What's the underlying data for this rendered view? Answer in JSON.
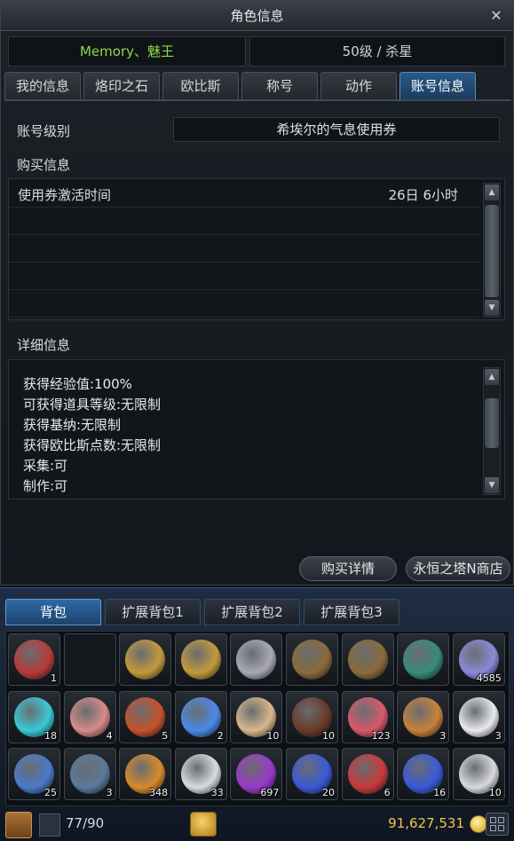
{
  "window": {
    "title": "角色信息",
    "close_glyph": "✕"
  },
  "character": {
    "name": "Memory、魅王",
    "level_class": "50级 / 杀星"
  },
  "tabs": [
    {
      "label": "我的信息"
    },
    {
      "label": "烙印之石"
    },
    {
      "label": "欧比斯"
    },
    {
      "label": "称号"
    },
    {
      "label": "动作"
    },
    {
      "label": "账号信息",
      "active": true
    }
  ],
  "account": {
    "level_label": "账号级别",
    "level_value": "希埃尔的气息使用券",
    "purchase_label": "购买信息",
    "purchase_rows": [
      {
        "key": "使用券激活时间",
        "value": "26日 6小时"
      }
    ],
    "detail_label": "详细信息",
    "detail_lines": [
      "获得经验值:100%",
      "可获得道具等级:无限制",
      "获得基纳:无限制",
      "获得欧比斯点数:无限制",
      "采集:可",
      "制作:可"
    ]
  },
  "buttons": {
    "purchase_detail": "购买详情",
    "shop": "永恒之塔N商店"
  },
  "inventory": {
    "tabs": [
      {
        "label": "背包",
        "active": true
      },
      {
        "label": "扩展背包1"
      },
      {
        "label": "扩展背包2"
      },
      {
        "label": "扩展背包3"
      }
    ],
    "slots": [
      {
        "icon": "red-feather-icon",
        "count": "1",
        "color": "#b83a3a"
      },
      {
        "icon": "empty-slot-icon",
        "count": "",
        "color": ""
      },
      {
        "icon": "gold-helmet-icon",
        "count": "",
        "color": "#c39a3c"
      },
      {
        "icon": "gold-helmet-icon",
        "count": "",
        "color": "#c39a3c"
      },
      {
        "icon": "necklace-icon",
        "count": "",
        "color": "#a9a9b8"
      },
      {
        "icon": "ring-icon",
        "count": "",
        "color": "#8a6a3a"
      },
      {
        "icon": "ring-icon",
        "count": "",
        "color": "#8a6a3a"
      },
      {
        "icon": "bracelet-icon",
        "count": "",
        "color": "#3a8a7a"
      },
      {
        "icon": "crystal-shard-icon",
        "count": "4585",
        "color": "#8a8ad8"
      },
      {
        "icon": "cyan-flame-icon",
        "count": "18",
        "color": "#3ac8d8"
      },
      {
        "icon": "raw-meat-icon",
        "count": "4",
        "color": "#d88a8a"
      },
      {
        "icon": "sausage-icon",
        "count": "5",
        "color": "#c8522a"
      },
      {
        "icon": "blue-orb-icon",
        "count": "2",
        "color": "#4a8ae8"
      },
      {
        "icon": "bread-icon",
        "count": "10",
        "color": "#d8b88a"
      },
      {
        "icon": "chocolate-icon",
        "count": "10",
        "color": "#6a3a2a"
      },
      {
        "icon": "jelly-icon",
        "count": "123",
        "color": "#d85a6a"
      },
      {
        "icon": "bun-basket-icon",
        "count": "3",
        "color": "#c8823a"
      },
      {
        "icon": "polar-bear-icon",
        "count": "3",
        "color": "#e8eaec"
      },
      {
        "icon": "blue-dragon-icon",
        "count": "25",
        "color": "#4a7ac8"
      },
      {
        "icon": "dark-crystal-icon",
        "count": "3",
        "color": "#5a7a9a"
      },
      {
        "icon": "amber-potion-icon",
        "count": "348",
        "color": "#d88a2a"
      },
      {
        "icon": "white-potion-icon",
        "count": "33",
        "color": "#d8dadc"
      },
      {
        "icon": "purple-potion-icon",
        "count": "697",
        "color": "#9a3ac8"
      },
      {
        "icon": "blue-potion-icon",
        "count": "20",
        "color": "#3a5ad8"
      },
      {
        "icon": "red-potion-icon",
        "count": "6",
        "color": "#c83a3a"
      },
      {
        "icon": "blue-potion-icon",
        "count": "16",
        "color": "#3a5ad8"
      },
      {
        "icon": "white-potion-icon",
        "count": "10",
        "color": "#d8dadc"
      }
    ],
    "capacity": "77/90",
    "gold": "91,627,531"
  }
}
